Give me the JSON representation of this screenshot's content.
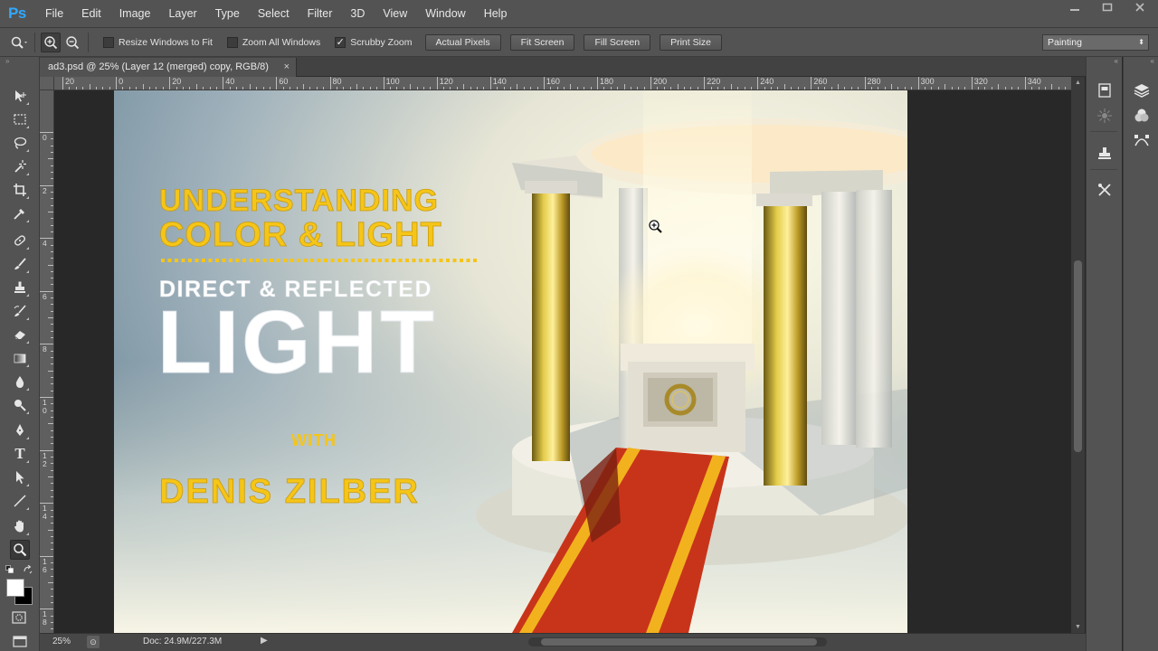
{
  "app": {
    "logo": "Ps",
    "menus": [
      "File",
      "Edit",
      "Image",
      "Layer",
      "Type",
      "Select",
      "Filter",
      "3D",
      "View",
      "Window",
      "Help"
    ],
    "window_controls": [
      "minimize",
      "restore",
      "close"
    ]
  },
  "options_bar": {
    "checkboxes": [
      {
        "label": "Resize Windows to Fit",
        "checked": false
      },
      {
        "label": "Zoom All Windows",
        "checked": false
      },
      {
        "label": "Scrubby Zoom",
        "checked": true
      }
    ],
    "buttons": [
      "Actual Pixels",
      "Fit Screen",
      "Fill Screen",
      "Print Size"
    ],
    "workspace": "Painting"
  },
  "document": {
    "tab_title": "ad3.psd @ 25% (Layer 12 (merged) copy, RGB/8)",
    "close_glyph": "×"
  },
  "ruler": {
    "horizontal_labels": [
      "20",
      "0",
      "20",
      "40",
      "60",
      "80",
      "100",
      "120",
      "140",
      "160",
      "180",
      "200",
      "220",
      "240",
      "260",
      "280",
      "300",
      "320",
      "340"
    ],
    "vertical_labels": [
      "0",
      "2",
      "4",
      "6",
      "8",
      "10",
      "12",
      "14",
      "16",
      "18"
    ]
  },
  "artwork": {
    "title_line1": "UNDERSTANDING",
    "title_line2": "COLOR & LIGHT",
    "subtitle": "DIRECT & REFLECTED",
    "big_word": "LIGHT",
    "with": "WITH",
    "author": "DENIS ZILBER",
    "colors": {
      "title_yellow": "#f5c518",
      "white_text": "#ffffff",
      "carpet_red": "#c8341a",
      "carpet_stripe": "#f2b21e",
      "gold_pillar": "#c9a82a",
      "bg_blue": "#6f8a9c",
      "bg_cream": "#f4f0de"
    }
  },
  "status": {
    "zoom": "25%",
    "doc_size": "Doc: 24.9M/227.3M"
  },
  "tools": [
    "move-tool",
    "rectangular-marquee-tool",
    "lasso-tool",
    "magic-wand-tool",
    "crop-tool",
    "eyedropper-tool",
    "spot-healing-tool",
    "brush-tool",
    "clone-stamp-tool",
    "history-brush-tool",
    "eraser-tool",
    "gradient-tool",
    "blur-tool",
    "dodge-tool",
    "pen-tool",
    "type-tool",
    "path-selection-tool",
    "line-tool",
    "hand-tool",
    "zoom-tool"
  ],
  "active_tool": "zoom-tool"
}
